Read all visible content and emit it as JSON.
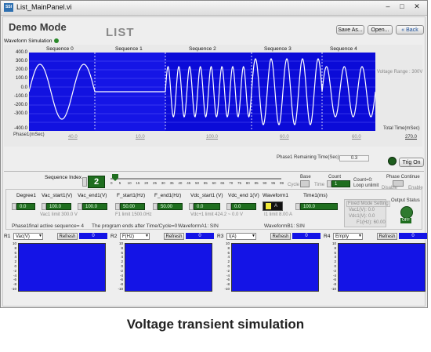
{
  "window": {
    "title": "List_MainPanel.vi",
    "icon_text": "SSI"
  },
  "header": {
    "mode": "Demo Mode",
    "list": "LIST",
    "buttons": {
      "save": "Save As...",
      "open": "Open...",
      "back": "Back"
    }
  },
  "waveform": {
    "title": "Waveform Simulation",
    "sequences": [
      "Sequence 0",
      "Sequence 1",
      "Sequence 2",
      "Sequence 3",
      "Sequence 4"
    ],
    "y_ticks": [
      "400.0",
      "300.0",
      "200.0",
      "100.0",
      "0.0",
      "-100.0",
      "-200.0",
      "-300.0",
      "-400.0"
    ],
    "voltage_range": "Voltage Range : 300V",
    "total_time_label": "Total Time(mSec)",
    "total_time_value": "270.0",
    "phase_label": "Phase1(mSec)",
    "phase_times": [
      "40.0",
      "10.0",
      "100.0",
      "60.0",
      "60.0"
    ],
    "remaining_label": "Phase1 Remaining Time(Sec)",
    "remaining_value": "0.3",
    "trig_button": "Trig On"
  },
  "sequence": {
    "index_label": "Sequence Index",
    "index_value": "2",
    "slider_ticks": [
      "0",
      "5",
      "10",
      "15",
      "20",
      "25",
      "30",
      "35",
      "40",
      "45",
      "50",
      "55",
      "60",
      "65",
      "70",
      "75",
      "80",
      "85",
      "90",
      "95",
      "99"
    ],
    "base_label": "Base",
    "cycle_label": "Cycle",
    "time_label": "Time",
    "count_label": "Count",
    "count_value": "1",
    "count_note1": "Count=0:",
    "count_note2": "Loop unlimit",
    "phase_continue": "Phase Continue",
    "disable": "Disable",
    "enable": "Enable"
  },
  "params": {
    "headers": [
      "Degree1",
      "Vac_start1(V)",
      "Vac_end1(V)",
      "F_start1(Hz)",
      "F_end1(Hz)",
      "Vdc_start1 (V)",
      "Vdc_end 1(V)",
      "Waveform1",
      "Time1(ms)"
    ],
    "values": [
      "0.0",
      "100.0",
      "100.0",
      "50.00",
      "50.00",
      "0.0",
      "0.0",
      "A",
      "100.0"
    ],
    "vac_limit": "Vac1 limit  300.0 V",
    "f1_limit": "F1 limit  1500.0Hz",
    "vdc_limit": "Vdc+1 limit  424.2  ~  0.0  V",
    "i1_limit": "I1 limit 8.00  A",
    "fixed_title": "Fixed Mode Setting",
    "fixed_vac": "Vac1(V):  0.0",
    "fixed_vdc": "Vdc1(V):  0.0",
    "fixed_f": "F1(Hz):  60.00",
    "output_status": "Output Status",
    "off": "OFF"
  },
  "info": {
    "final_seq": "Phase1final active sequence=  4",
    "program_end": "The program ends after Time/Cycle=0",
    "waveA": "WaveformA1:  SIN",
    "waveB": "WaveformB1:  SIN"
  },
  "plots": [
    {
      "label": "R1",
      "select": "Vac(V)",
      "refresh": "Refresh",
      "value": "0"
    },
    {
      "label": "R2",
      "select": "F(Hz)",
      "refresh": "Refresh",
      "value": "0"
    },
    {
      "label": "R3",
      "select": "I(A)",
      "refresh": "Refresh",
      "value": "0"
    },
    {
      "label": "R4",
      "select": "Empty",
      "refresh": "Refresh",
      "value": "0"
    }
  ],
  "plot_ticks": [
    "10",
    "8",
    "6",
    "4",
    "2",
    "0",
    "-2",
    "-4",
    "-6",
    "-8",
    "-10"
  ],
  "caption": "Voltage transient simulation",
  "colors": {
    "plot_bg": "#1414e6",
    "field_green": "#1f6e1f",
    "panel": "#eeeeee"
  }
}
